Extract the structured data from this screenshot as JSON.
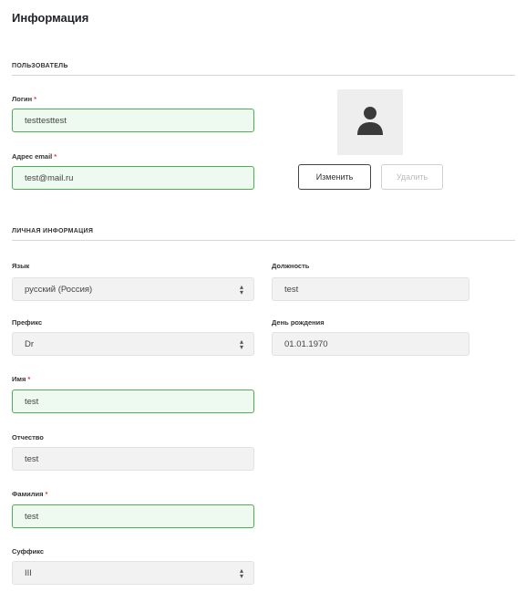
{
  "page": {
    "title": "Информация"
  },
  "user_section": {
    "title": "ПОЛЬЗОВАТЕЛЬ",
    "login": {
      "label": "Логин",
      "required": "*",
      "value": "testtesttest"
    },
    "email": {
      "label": "Адрес email",
      "required": "*",
      "value": "test@mail.ru"
    },
    "avatar": {
      "icon": "user-silhouette-icon"
    },
    "change_button": "Изменить",
    "delete_button": "Удалить"
  },
  "personal_section": {
    "title": "ЛИЧНАЯ ИНФОРМАЦИЯ",
    "language": {
      "label": "Язык",
      "value": "русский (Россия)"
    },
    "position": {
      "label": "Должность",
      "value": "test"
    },
    "prefix": {
      "label": "Префикс",
      "value": "Dr"
    },
    "birthday": {
      "label": "День рождения",
      "value": "01.01.1970"
    },
    "first_name": {
      "label": "Имя",
      "required": "*",
      "value": "test"
    },
    "middle_name": {
      "label": "Отчество",
      "value": "test"
    },
    "last_name": {
      "label": "Фамилия",
      "required": "*",
      "value": "test"
    },
    "suffix": {
      "label": "Суффикс",
      "value": "III"
    }
  },
  "colors": {
    "valid_border": "#4caf50",
    "valid_background": "#eef9ef",
    "required_marker": "#e23b3b",
    "readonly_background": "#f2f2f2"
  }
}
